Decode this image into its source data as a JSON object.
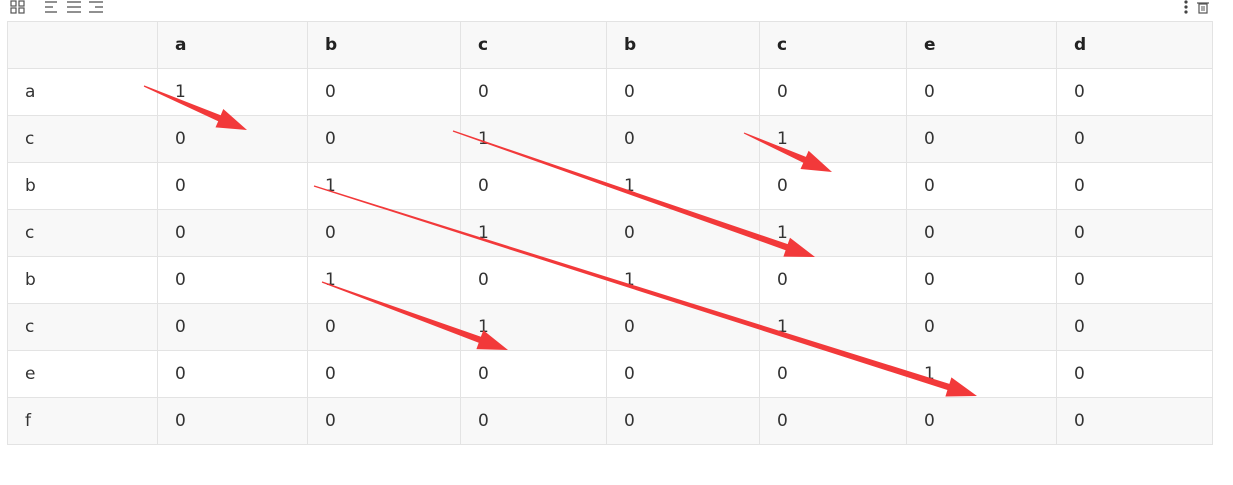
{
  "toolbar": {
    "left_icons": [
      "grid-icon",
      "align-left-icon",
      "align-center-icon",
      "align-right-icon"
    ],
    "right_icons": [
      "more-vertical-icon",
      "delete-icon"
    ]
  },
  "table": {
    "corner": "",
    "columns": [
      "a",
      "b",
      "c",
      "b",
      "c",
      "e",
      "d"
    ],
    "rows": [
      {
        "label": "a",
        "cells": [
          "1",
          "0",
          "0",
          "0",
          "0",
          "0",
          "0"
        ]
      },
      {
        "label": "c",
        "cells": [
          "0",
          "0",
          "1",
          "0",
          "1",
          "0",
          "0"
        ]
      },
      {
        "label": "b",
        "cells": [
          "0",
          "1",
          "0",
          "1",
          "0",
          "0",
          "0"
        ]
      },
      {
        "label": "c",
        "cells": [
          "0",
          "0",
          "1",
          "0",
          "1",
          "0",
          "0"
        ]
      },
      {
        "label": "b",
        "cells": [
          "0",
          "1",
          "0",
          "1",
          "0",
          "0",
          "0"
        ]
      },
      {
        "label": "c",
        "cells": [
          "0",
          "0",
          "1",
          "0",
          "1",
          "0",
          "0"
        ]
      },
      {
        "label": "e",
        "cells": [
          "0",
          "0",
          "0",
          "0",
          "0",
          "1",
          "0"
        ]
      },
      {
        "label": "f",
        "cells": [
          "0",
          "0",
          "0",
          "0",
          "0",
          "0",
          "0"
        ]
      }
    ]
  },
  "annotation_color": "#f2393a"
}
